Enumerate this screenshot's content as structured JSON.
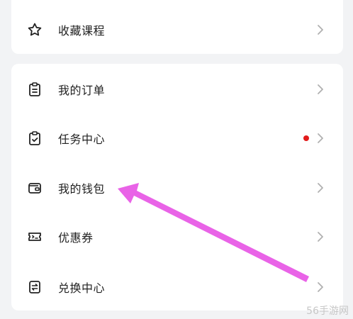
{
  "favorites": {
    "label": "收藏课程",
    "icon": "star-icon"
  },
  "menu": [
    {
      "label": "我的订单",
      "icon": "order-clipboard-icon",
      "has_dot": false
    },
    {
      "label": "任务中心",
      "icon": "task-check-icon",
      "has_dot": true
    },
    {
      "label": "我的钱包",
      "icon": "wallet-icon",
      "has_dot": false
    },
    {
      "label": "优惠券",
      "icon": "coupon-ticket-icon",
      "has_dot": false
    },
    {
      "label": "兑换中心",
      "icon": "exchange-icon",
      "has_dot": false
    }
  ],
  "colors": {
    "text": "#222222",
    "icon": "#222222",
    "chevron": "#b0b0b0",
    "dot": "#e21b1b",
    "arrow": "#e85be6",
    "background": "#f2f3f5"
  },
  "watermark": "56手游网"
}
